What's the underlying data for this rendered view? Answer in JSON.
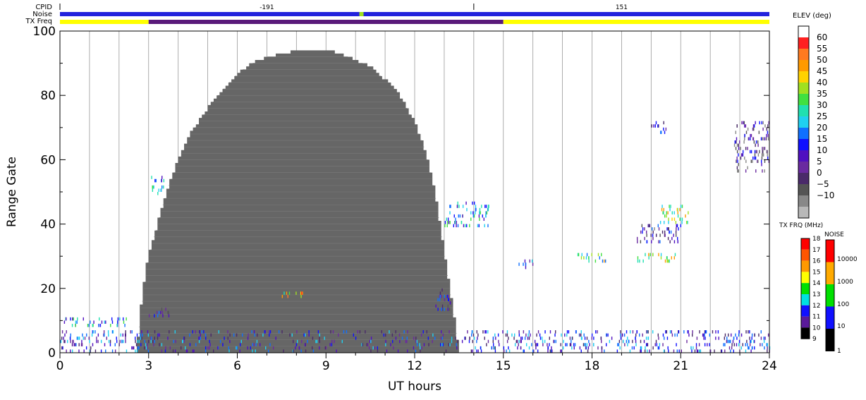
{
  "chart_data": {
    "type": "heatmap",
    "title": "",
    "xlabel": "UT hours",
    "ylabel": "Range Gate",
    "xlim": [
      0,
      24
    ],
    "ylim": [
      0,
      100
    ],
    "x_ticks": [
      "0",
      "3",
      "6",
      "9",
      "12",
      "15",
      "18",
      "21",
      "24"
    ],
    "y_ticks": [
      "0",
      "20",
      "40",
      "60",
      "80",
      "100"
    ],
    "header_rows": {
      "cpid_label": "CPID",
      "noise_label": "Noise",
      "txfreq_label": "TX Freq",
      "cpid_values": [
        "-191",
        "151"
      ],
      "cpid_change_hour": 14.0,
      "noise_color": "#2222dd",
      "noise_spike_hour": 10.2,
      "txfreq_segments": [
        {
          "start": 0,
          "end": 3,
          "color": "#ffff00"
        },
        {
          "start": 3,
          "end": 15,
          "color": "#5a1a7a"
        },
        {
          "start": 15,
          "end": 24,
          "color": "#ffff00"
        }
      ]
    },
    "ground_scatter_region": {
      "color": "#666666",
      "profile": [
        [
          2.6,
          0
        ],
        [
          2.75,
          15
        ],
        [
          2.9,
          25
        ],
        [
          3.0,
          30
        ],
        [
          3.3,
          40
        ],
        [
          3.6,
          50
        ],
        [
          4.0,
          60
        ],
        [
          4.4,
          68
        ],
        [
          5.0,
          76
        ],
        [
          5.5,
          82
        ],
        [
          6.0,
          87
        ],
        [
          6.5,
          90
        ],
        [
          7.0,
          92
        ],
        [
          8.0,
          94
        ],
        [
          9.0,
          94
        ],
        [
          9.5,
          93
        ],
        [
          10.0,
          91
        ],
        [
          10.5,
          89
        ],
        [
          11.0,
          85
        ],
        [
          11.5,
          80
        ],
        [
          12.0,
          72
        ],
        [
          12.4,
          62
        ],
        [
          12.7,
          50
        ],
        [
          12.95,
          35
        ],
        [
          13.2,
          20
        ],
        [
          13.4,
          8
        ],
        [
          13.5,
          0
        ]
      ]
    },
    "scatter_clusters": [
      {
        "x0": 3.0,
        "x1": 3.5,
        "y0": 49,
        "y1": 55,
        "elev": 25
      },
      {
        "x0": 3.0,
        "x1": 3.7,
        "y0": 11,
        "y1": 14,
        "elev": 12
      },
      {
        "x0": 7.5,
        "x1": 8.3,
        "y0": 17,
        "y1": 19,
        "elev": 47
      },
      {
        "x0": 12.7,
        "x1": 13.3,
        "y0": 13,
        "y1": 20,
        "elev": 10
      },
      {
        "x0": 13.0,
        "x1": 14.5,
        "y0": 39,
        "y1": 47,
        "elev": 25
      },
      {
        "x0": 15.5,
        "x1": 16.0,
        "y0": 26,
        "y1": 29,
        "elev": 12
      },
      {
        "x0": 17.5,
        "x1": 18.5,
        "y0": 28,
        "y1": 31,
        "elev": 37
      },
      {
        "x0": 19.5,
        "x1": 20.8,
        "y0": 28,
        "y1": 31,
        "elev": 40
      },
      {
        "x0": 19.5,
        "x1": 21.0,
        "y0": 34,
        "y1": 40,
        "elev": 7
      },
      {
        "x0": 20.3,
        "x1": 21.3,
        "y0": 40,
        "y1": 46,
        "elev": 40
      },
      {
        "x0": 22.8,
        "x1": 24.0,
        "y0": 56,
        "y1": 72,
        "elev": 5
      },
      {
        "x0": 20.0,
        "x1": 20.5,
        "y0": 68,
        "y1": 72,
        "elev": 12
      },
      {
        "x0": 0.1,
        "x1": 2.3,
        "y0": 8,
        "y1": 11,
        "elev": 25
      },
      {
        "x0": 0.0,
        "x1": 24.0,
        "y0": 0,
        "y1": 7,
        "elev": 15
      }
    ],
    "elev_scale": {
      "title": "ELEV (deg)",
      "labels": [
        "60",
        "55",
        "50",
        "45",
        "40",
        "35",
        "30",
        "25",
        "20",
        "15",
        "10",
        "5",
        "0",
        "−5",
        "−10"
      ],
      "colors": [
        "#ffffff",
        "#ff2020",
        "#ff7a20",
        "#ff9a00",
        "#ffd200",
        "#a0e020",
        "#40e040",
        "#20e0b0",
        "#20d0f0",
        "#1070ff",
        "#1010ff",
        "#5010c0",
        "#6a2aa0",
        "#4a2a6a",
        "#555555",
        "#888888",
        "#b8b8b8"
      ]
    },
    "txfrq_scale": {
      "title": "TX FRQ (MHz)",
      "labels": [
        "18",
        "17",
        "16",
        "15",
        "14",
        "13",
        "12",
        "11",
        "10",
        "9"
      ],
      "colors": [
        "#ff0000",
        "#ff5500",
        "#ff9900",
        "#ffff00",
        "#00e000",
        "#00e0e0",
        "#1010ff",
        "#5a1a9a",
        "#000000"
      ]
    },
    "noise_scale": {
      "title": "NOISE",
      "labels": [
        "10000",
        "1000",
        "100",
        "10",
        "1"
      ],
      "colors": [
        "#ff0000",
        "#ffaa00",
        "#00e000",
        "#1010ff",
        "#000000"
      ]
    }
  }
}
